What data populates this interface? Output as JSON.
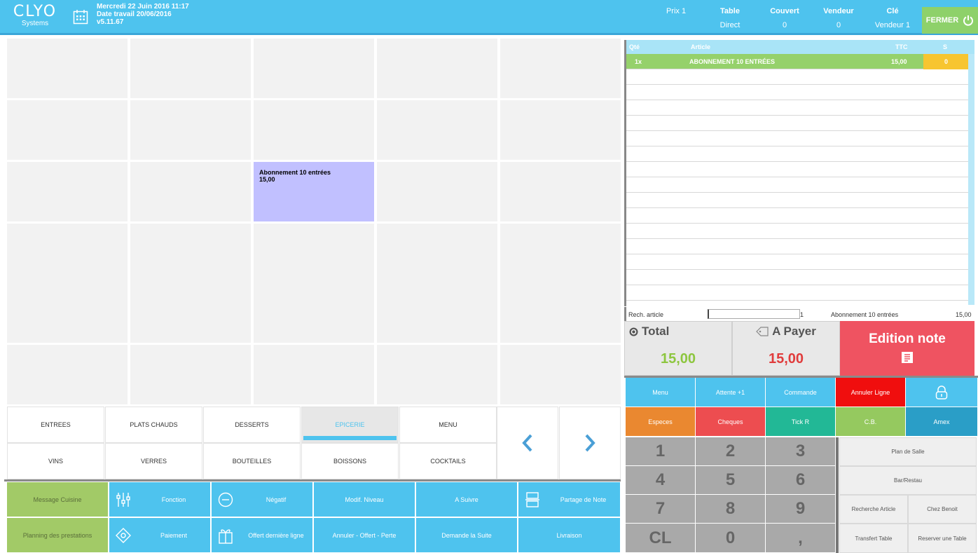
{
  "header": {
    "logo": "CLYO",
    "logo_sub": "Systems",
    "datetime": "Mercredi 22 Juin 2016 11:17",
    "work_date": "Date travail 20/06/2016",
    "version": "v5.11.67",
    "price_label": "Prix 1",
    "table_label": "Table",
    "table_value": "Direct",
    "couvert_label": "Couvert",
    "couvert_value": "0",
    "vendeur_label": "Vendeur",
    "vendeur_value": "0",
    "cle_label": "Clé",
    "cle_value": "Vendeur 1",
    "close_label": "FERMER"
  },
  "grid": {
    "product_name": "Abonnement 10 entrées",
    "product_price": "15,00"
  },
  "categories": {
    "row1": [
      "ENTREES",
      "PLATS CHAUDS",
      "DESSERTS",
      "EPICERIE",
      "MENU"
    ],
    "row2": [
      "VINS",
      "VERRES",
      "BOUTEILLES",
      "BOISSONS",
      "COCKTAILS"
    ],
    "selected": "EPICERIE"
  },
  "functions": {
    "message_cuisine": "Message Cuisine",
    "planning": "Planning des prestations",
    "fonction": "Fonction",
    "paiement": "Paiement",
    "negatif": "Négatif",
    "offert_derniere": "Offert dernière ligne",
    "modif_niveau": "Modif. Niveau",
    "annuler_offert": "Annuler - Offert - Perte",
    "a_suivre": "A Suivre",
    "demande_suite": "Demande la Suite",
    "partage_note": "Partage de Note",
    "livraison": "Livraison"
  },
  "ticket": {
    "col_qty": "Qté",
    "col_article": "Article",
    "col_ttc": "TTC",
    "col_s": "S",
    "lines": [
      {
        "qty": "1x",
        "article": "ABONNEMENT 10 ENTRÉES",
        "ttc": "15,00",
        "s": "0"
      }
    ]
  },
  "search": {
    "label": "Rech. article",
    "value": "",
    "count": "1",
    "last_article": "Abonnement 10 entrées",
    "last_price": "15,00"
  },
  "totals": {
    "total_label": "Total",
    "total_value": "15,00",
    "payer_label": "A Payer",
    "payer_value": "15,00",
    "edition_label": "Edition note"
  },
  "actions": {
    "menu": "Menu",
    "attente": "Attente +1",
    "commande": "Commande",
    "annuler_ligne": "Annuler Ligne"
  },
  "payments": {
    "especes": "Especes",
    "cheques": "Cheques",
    "tickr": "Tick R",
    "cb": "C.B.",
    "amex": "Amex"
  },
  "keypad": {
    "k1": "1",
    "k2": "2",
    "k3": "3",
    "k4": "4",
    "k5": "5",
    "k6": "6",
    "k7": "7",
    "k8": "8",
    "k9": "9",
    "kcl": "CL",
    "k0": "0",
    "kcomma": ","
  },
  "side": {
    "plan_salle": "Plan de Salle",
    "bar_restau": "Bar/Restau",
    "recherche_article": "Recherche Article",
    "chez_benoit": "Chez Benoit",
    "transfert_table": "Transfert Table",
    "reserver_table": "Reserver une Table"
  },
  "colors": {
    "accent": "#4ec3ee",
    "green": "#95d16b",
    "red": "#ef5361",
    "orange": "#ea8830",
    "product": "#c1c0ff"
  }
}
